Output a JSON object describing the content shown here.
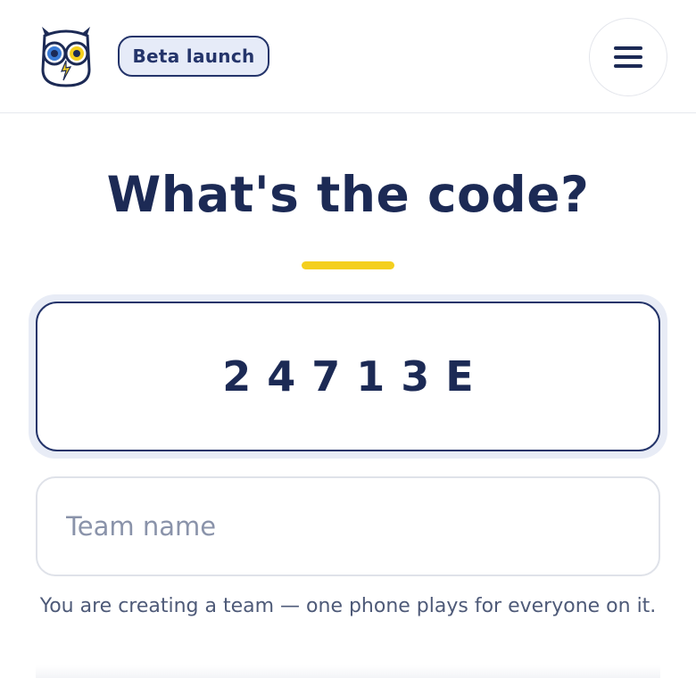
{
  "header": {
    "logo_icon": "owl-logo-icon",
    "badge_label": "Beta launch",
    "menu_icon": "hamburger-menu-icon"
  },
  "main": {
    "title": "What's the code?",
    "code_value": "24713E",
    "team_name_placeholder": "Team name",
    "team_name_value": "",
    "helper_text": "You are creating a team — one phone plays for everyone on it."
  },
  "colors": {
    "navy": "#1c2a55",
    "accent_yellow": "#f4cf1e",
    "badge_bg": "#e6ebf8"
  }
}
